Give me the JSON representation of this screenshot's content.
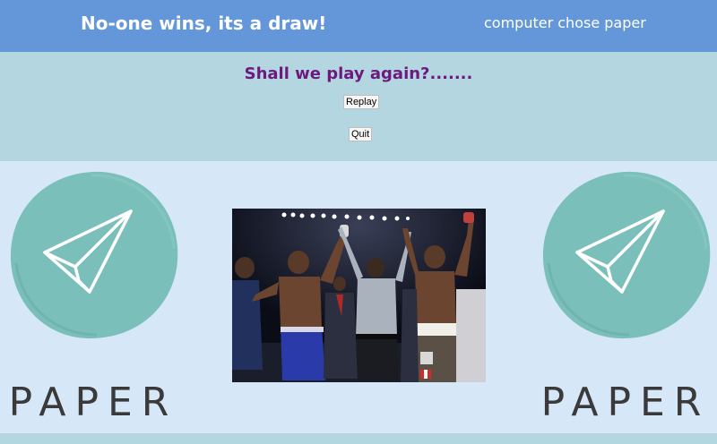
{
  "header": {
    "result": "No-one wins, its a draw!",
    "computer_choice": "computer chose paper"
  },
  "replay": {
    "question": "Shall we play again?.......",
    "replay_label": "Replay",
    "quit_label": "Quit"
  },
  "player_choice": {
    "label": "PAPER",
    "icon": "paper-plane-icon"
  },
  "computer_pick": {
    "label": "PAPER",
    "icon": "paper-plane-icon"
  },
  "center_image": {
    "subject": "boxing-match-draw-photo"
  },
  "colors": {
    "header_bg": "#6497d9",
    "section_bg": "#b4d6e1",
    "main_bg": "#d6e7f8",
    "accent_purple": "#6d1a7e",
    "circle_teal": "#7abfba"
  }
}
